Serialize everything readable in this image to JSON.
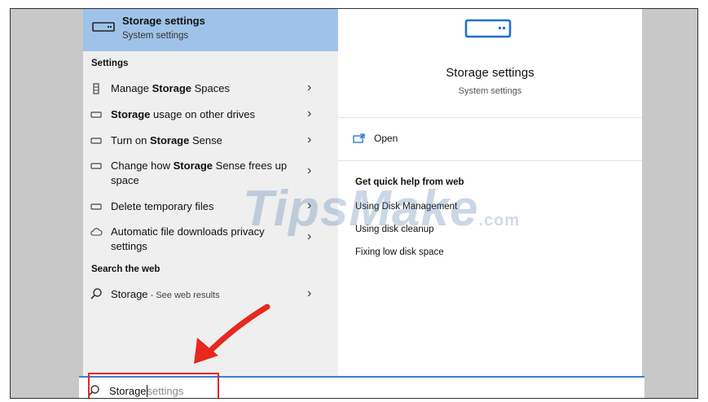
{
  "best_match": {
    "title": "Storage settings",
    "subtitle": "System settings",
    "icon": "drive-icon"
  },
  "settings_section": {
    "header": "Settings",
    "items": [
      {
        "pre": "Manage ",
        "bold": "Storage",
        "post": " Spaces",
        "icon": "storage-spaces-icon"
      },
      {
        "pre": "",
        "bold": "Storage",
        "post": " usage on other drives",
        "icon": "drive-icon"
      },
      {
        "pre": "Turn on ",
        "bold": "Storage",
        "post": " Sense",
        "icon": "drive-icon"
      },
      {
        "pre": "Change how ",
        "bold": "Storage",
        "post": " Sense frees up space",
        "icon": "drive-icon"
      },
      {
        "pre": "Delete temporary files",
        "bold": "",
        "post": "",
        "icon": "drive-icon"
      },
      {
        "pre": "Automatic file downloads privacy settings",
        "bold": "",
        "post": "",
        "icon": "cloud-icon"
      }
    ]
  },
  "web_section": {
    "header": "Search the web",
    "item": {
      "label": "Storage",
      "hint": " - See web results",
      "icon": "search-icon"
    }
  },
  "detail": {
    "title": "Storage settings",
    "subtitle": "System settings",
    "open_label": "Open",
    "quick_help_header": "Get quick help from web",
    "links": [
      "Using Disk Management",
      "Using disk cleanup",
      "Fixing low disk space"
    ]
  },
  "search": {
    "typed": "Storage",
    "suggestion": "settings"
  },
  "watermark": {
    "main": "TipsMake",
    "suffix": ".com"
  },
  "colors": {
    "selected": "#9fc3e8",
    "accent": "#3a7fd1",
    "highlight": "#e8281e"
  }
}
